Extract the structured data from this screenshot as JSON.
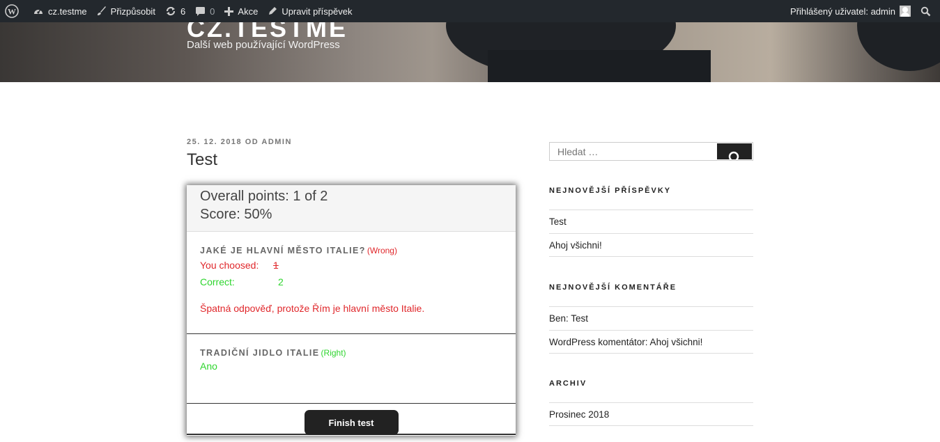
{
  "adminbar": {
    "site": "cz.testme",
    "customize": "Přizpůsobit",
    "updates": "6",
    "comments": "0",
    "new": "Akce",
    "edit": "Upravit příspěvek",
    "user": "Přihlášený uživatel: admin"
  },
  "header": {
    "title": "CZ.TESTME",
    "description": "Další web používající WordPress"
  },
  "post": {
    "meta": "25. 12. 2018 OD ADMIN",
    "title": "Test"
  },
  "quiz": {
    "overall": "Overall points: 1 of 2",
    "score": "Score: 50%",
    "q1": {
      "title": "JAKÉ JE HLAVNÍ MĚSTO ITALIE?",
      "status": "(Wrong)",
      "chosen_label": "You choosed:",
      "chosen_value": "1",
      "correct_label": "Correct:",
      "correct_value": "2",
      "explanation": "Špatná odpověď, protože Řím je hlavní město Italie."
    },
    "q2": {
      "title": "TRADIČNÍ JIDLO ITALIE",
      "status": "(Right)",
      "answer": "Ano"
    },
    "finish_label": "Finish test"
  },
  "sidebar": {
    "search_placeholder": "Hledat …",
    "recent_posts_title": "NEJNOVĚJŠÍ PŘÍSPĚVKY",
    "recent_posts": [
      "Test",
      "Ahoj všichni!"
    ],
    "recent_comments_title": "NEJNOVĚJŠÍ KOMENTÁŘE",
    "recent_comments": [
      "Ben: Test",
      "WordPress komentátor: Ahoj všichni!"
    ],
    "archive_title": "ARCHIV",
    "archive": [
      "Prosinec 2018"
    ]
  },
  "colors": {
    "adminbar_bg": "#23282d",
    "wrong": "#e0272b",
    "right": "#2ed52e",
    "button": "#222222"
  }
}
